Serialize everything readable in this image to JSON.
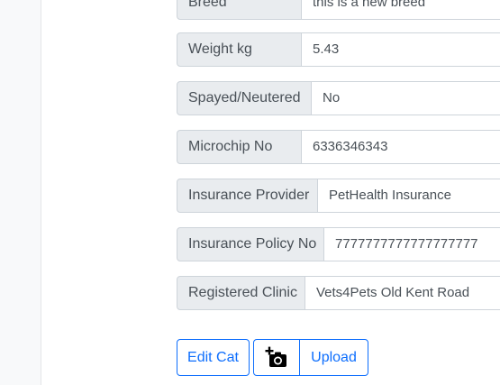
{
  "fields": [
    {
      "label": "Breed",
      "value": "this is a new breed"
    },
    {
      "label": "Weight kg",
      "value": "5.43"
    },
    {
      "label": "Spayed/Neutered",
      "value": "No"
    },
    {
      "label": "Microchip No",
      "value": "6336346343"
    },
    {
      "label": "Insurance Provider",
      "value": "PetHealth Insurance"
    },
    {
      "label": "Insurance Policy No",
      "value": "7777777777777777777"
    },
    {
      "label": "Registered Clinic",
      "value": "Vets4Pets Old Kent Road"
    }
  ],
  "actions": {
    "edit_label": "Edit Cat",
    "upload_label": "Upload",
    "camera_icon": "add-photo-icon"
  },
  "colors": {
    "primary": "#0d6efd",
    "label_bg": "#e9ecef",
    "border": "#ced4da",
    "text": "#495057"
  }
}
